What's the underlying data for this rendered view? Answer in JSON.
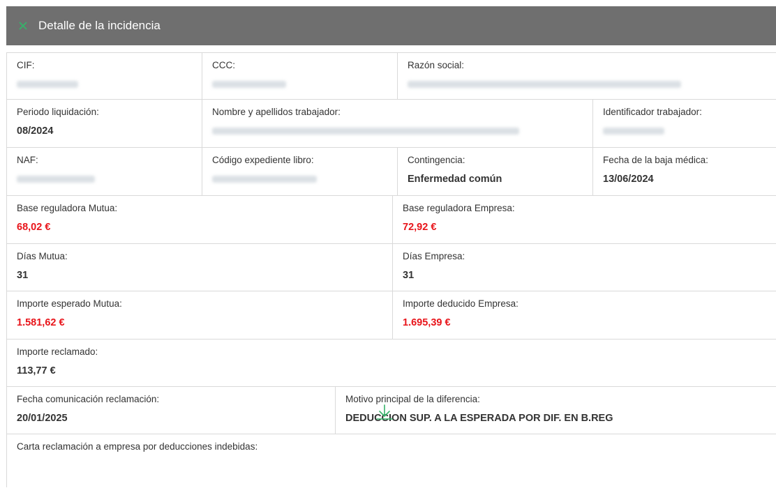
{
  "header": {
    "title": "Detalle de la incidencia",
    "close_icon": "close-icon"
  },
  "fields": {
    "cif": {
      "label": "CIF:"
    },
    "ccc": {
      "label": "CCC:"
    },
    "razon_social": {
      "label": "Razón social:"
    },
    "periodo": {
      "label": "Periodo liquidación:",
      "value": "08/2024"
    },
    "nombre": {
      "label": "Nombre y apellidos trabajador:"
    },
    "identificador": {
      "label": "Identificador trabajador:"
    },
    "naf": {
      "label": "NAF:"
    },
    "codigo_expediente": {
      "label": "Código expediente libro:"
    },
    "contingencia": {
      "label": "Contingencia:",
      "value": "Enfermedad común"
    },
    "fecha_baja": {
      "label": "Fecha de la baja médica:",
      "value": "13/06/2024"
    },
    "base_mutua": {
      "label": "Base reguladora Mutua:",
      "value": "68,02 €"
    },
    "base_empresa": {
      "label": "Base reguladora Empresa:",
      "value": "72,92 €"
    },
    "dias_mutua": {
      "label": "Días Mutua:",
      "value": "31"
    },
    "dias_empresa": {
      "label": "Días Empresa:",
      "value": "31"
    },
    "importe_esperado": {
      "label": "Importe esperado Mutua:",
      "value": "1.581,62 €"
    },
    "importe_deducido": {
      "label": "Importe deducido Empresa:",
      "value": "1.695,39 €"
    },
    "importe_reclamado": {
      "label": "Importe reclamado:",
      "value": "113,77 €"
    },
    "fecha_comunicacion": {
      "label": "Fecha comunicación reclamación:",
      "value": "20/01/2025"
    },
    "motivo": {
      "label": "Motivo principal de la diferencia:",
      "value": "DEDUCCION SUP. A LA ESPERADA POR DIF. EN B.REG"
    },
    "carta": {
      "label": "Carta reclamación a empresa por deducciones indebidas:",
      "download_icon": "download-icon"
    }
  },
  "colors": {
    "header_bg": "#6f6f6f",
    "accent_green": "#36b36a",
    "value_red": "#e8141a",
    "border": "#d9d9d9"
  }
}
